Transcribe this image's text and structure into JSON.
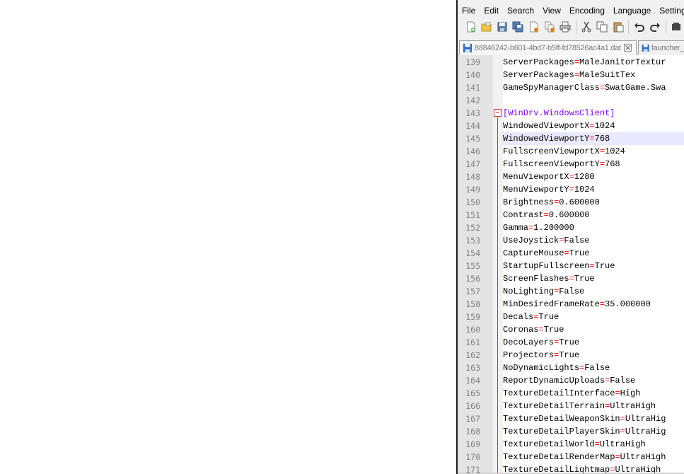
{
  "menu": [
    "File",
    "Edit",
    "Search",
    "View",
    "Encoding",
    "Language",
    "Settings"
  ],
  "toolbar": {
    "icons": [
      "new-file-icon",
      "open-file-icon",
      "save-icon",
      "save-all-icon",
      "close-icon",
      "close-all-icon",
      "print-icon",
      "cut-icon",
      "copy-icon",
      "paste-icon",
      "undo-icon",
      "redo-icon",
      "find-icon"
    ]
  },
  "tabs": [
    {
      "label": "88846242-b601-4bd7-b5ff-fd78526ac4a1.dat",
      "active": true
    },
    {
      "label": "launcher_",
      "active": false
    }
  ],
  "editor": {
    "current_line": 145,
    "lines": [
      {
        "num": "139",
        "key": "ServerPackages",
        "value": "MaleJanitorTextur"
      },
      {
        "num": "140",
        "key": "ServerPackages",
        "value": "MaleSuitTex"
      },
      {
        "num": "141",
        "key": "GameSpyManagerClass",
        "value": "SwatGame.Swa"
      },
      {
        "num": "142",
        "key": "",
        "value": ""
      },
      {
        "num": "143",
        "section": "[WinDrv.WindowsClient]"
      },
      {
        "num": "144",
        "key": "WindowedViewportX",
        "value": "1024"
      },
      {
        "num": "145",
        "key": "WindowedViewportY",
        "value": "768"
      },
      {
        "num": "146",
        "key": "FullscreenViewportX",
        "value": "1024"
      },
      {
        "num": "147",
        "key": "FullscreenViewportY",
        "value": "768"
      },
      {
        "num": "148",
        "key": "MenuViewportX",
        "value": "1280"
      },
      {
        "num": "149",
        "key": "MenuViewportY",
        "value": "1024"
      },
      {
        "num": "150",
        "key": "Brightness",
        "value": "0.600000"
      },
      {
        "num": "151",
        "key": "Contrast",
        "value": "0.600000"
      },
      {
        "num": "152",
        "key": "Gamma",
        "value": "1.200000"
      },
      {
        "num": "153",
        "key": "UseJoystick",
        "value": "False"
      },
      {
        "num": "154",
        "key": "CaptureMouse",
        "value": "True"
      },
      {
        "num": "155",
        "key": "StartupFullscreen",
        "value": "True"
      },
      {
        "num": "156",
        "key": "ScreenFlashes",
        "value": "True"
      },
      {
        "num": "157",
        "key": "NoLighting",
        "value": "False"
      },
      {
        "num": "158",
        "key": "MinDesiredFrameRate",
        "value": "35.000000"
      },
      {
        "num": "159",
        "key": "Decals",
        "value": "True"
      },
      {
        "num": "160",
        "key": "Coronas",
        "value": "True"
      },
      {
        "num": "161",
        "key": "DecoLayers",
        "value": "True"
      },
      {
        "num": "162",
        "key": "Projectors",
        "value": "True"
      },
      {
        "num": "163",
        "key": "NoDynamicLights",
        "value": "False"
      },
      {
        "num": "164",
        "key": "ReportDynamicUploads",
        "value": "False"
      },
      {
        "num": "165",
        "key": "TextureDetailInterface",
        "value": "High"
      },
      {
        "num": "166",
        "key": "TextureDetailTerrain",
        "value": "UltraHigh"
      },
      {
        "num": "167",
        "key": "TextureDetailWeaponSkin",
        "value": "UltraHig"
      },
      {
        "num": "168",
        "key": "TextureDetailPlayerSkin",
        "value": "UltraHig"
      },
      {
        "num": "169",
        "key": "TextureDetailWorld",
        "value": "UltraHigh"
      },
      {
        "num": "170",
        "key": "TextureDetailRenderMap",
        "value": "UltraHigh"
      },
      {
        "num": "171",
        "key": "TextureDetailLightmap",
        "value": "UltraHigh"
      }
    ]
  }
}
